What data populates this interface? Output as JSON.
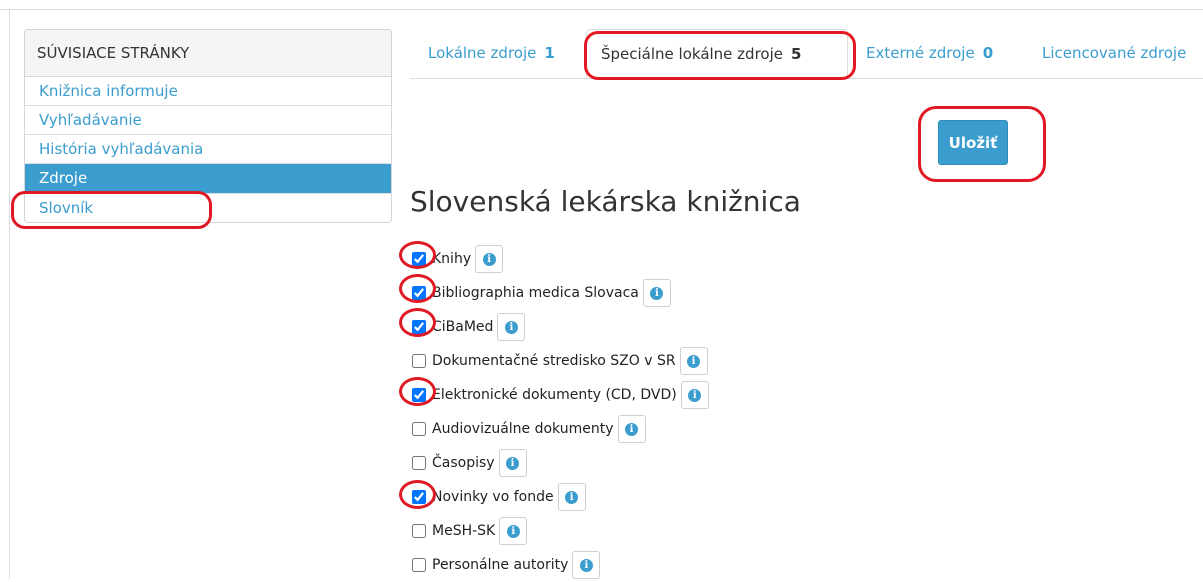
{
  "sidebar": {
    "header": "SÚVISIACE STRÁNKY",
    "items": [
      {
        "label": "Knižnica informuje",
        "active": false
      },
      {
        "label": "Vyhľadávanie",
        "active": false
      },
      {
        "label": "História vyhľadávania",
        "active": false
      },
      {
        "label": "Zdroje",
        "active": true
      },
      {
        "label": "Slovník",
        "active": false
      }
    ]
  },
  "tabs": [
    {
      "label": "Lokálne zdroje",
      "count": "1",
      "active": false
    },
    {
      "label": "Špeciálne lokálne zdroje",
      "count": "5",
      "active": true
    },
    {
      "label": "Externé zdroje",
      "count": "0",
      "active": false
    },
    {
      "label": "Licencované zdroje",
      "count": "",
      "active": false
    }
  ],
  "save_button": {
    "label": "Uložiť"
  },
  "library_title": "Slovenská lekárska knižnica",
  "sources": [
    {
      "label": "Knihy",
      "checked": true
    },
    {
      "label": "Bibliographia medica Slovaca",
      "checked": true
    },
    {
      "label": "CiBaMed",
      "checked": true
    },
    {
      "label": "Dokumentačné stredisko SZO v SR",
      "checked": false
    },
    {
      "label": "Elektronické dokumenty (CD, DVD)",
      "checked": true
    },
    {
      "label": "Audiovizuálne dokumenty",
      "checked": false
    },
    {
      "label": "Časopisy",
      "checked": false
    },
    {
      "label": "Novinky vo fonde",
      "checked": true
    },
    {
      "label": "MeSH-SK",
      "checked": false
    },
    {
      "label": "Personálne autority",
      "checked": false
    }
  ],
  "info_icon": "info-circle-icon",
  "colors": {
    "accent": "#3a9dce",
    "annotation": "#e01a24"
  }
}
